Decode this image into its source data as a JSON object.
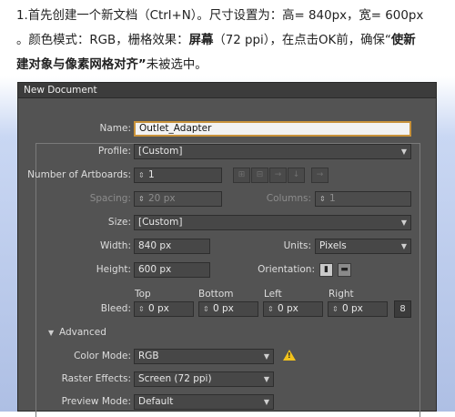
{
  "instructions": {
    "line1": "1.首先创建一个新文档（Ctrl+N）。尺寸设置为：高= 840px，宽= 600px",
    "line2_a": "。颜色模式：RGB，栅格效果：",
    "line2_b": "屏幕",
    "line2_c": "（72 ppi），在点击OK前，确保“",
    "line2_d": "使新",
    "line3_a": "建对象与像素网格对齐”",
    "line3_b": "未被选中。"
  },
  "dialog": {
    "title": "New Document",
    "name_label": "Name:",
    "name_value": "Outlet_Adapter",
    "profile_label": "Profile:",
    "profile_value": "[Custom]",
    "artboards_label": "Number of Artboards:",
    "artboards_value": "1",
    "spacing_label": "Spacing:",
    "spacing_value": "20 px",
    "columns_label": "Columns:",
    "columns_value": "1",
    "size_label": "Size:",
    "size_value": "[Custom]",
    "width_label": "Width:",
    "width_value": "840 px",
    "units_label": "Units:",
    "units_value": "Pixels",
    "height_label": "Height:",
    "height_value": "600 px",
    "orientation_label": "Orientation:",
    "bleed_label": "Bleed:",
    "bleed_top_label": "Top",
    "bleed_bottom_label": "Bottom",
    "bleed_left_label": "Left",
    "bleed_right_label": "Right",
    "bleed_top": "0 px",
    "bleed_bottom": "0 px",
    "bleed_left": "0 px",
    "bleed_right": "0 px",
    "advanced_label": "Advanced",
    "color_mode_label": "Color Mode:",
    "color_mode_value": "RGB",
    "raster_label": "Raster Effects:",
    "raster_value": "Screen (72 ppi)",
    "preview_label": "Preview Mode:",
    "preview_value": "Default"
  },
  "colors": {
    "dialog_bg": "#535353",
    "field_highlight": "#c8923a",
    "warning": "#f2c21b"
  }
}
